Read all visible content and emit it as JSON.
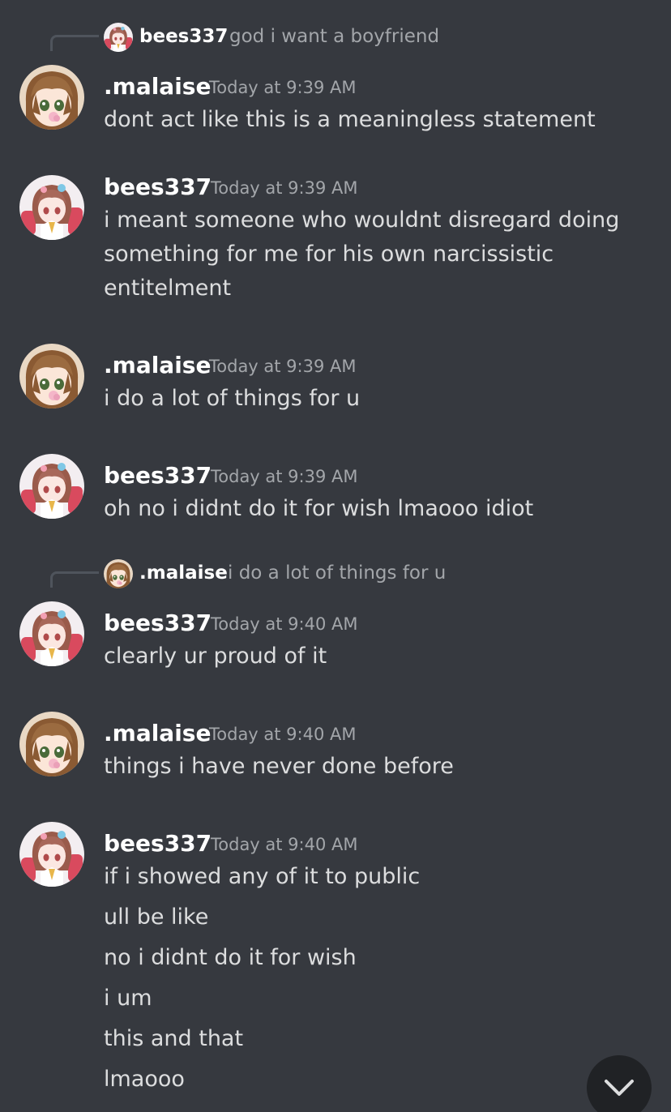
{
  "users": {
    "malaise": ".malaise",
    "bees": "bees337"
  },
  "colors": {
    "background": "#36393f",
    "username": "#ffffff",
    "text": "#dcddde",
    "muted": "#a3a6aa",
    "reply_spine": "#4f545c",
    "scroll_button": "#202225"
  },
  "messages": [
    {
      "reply": {
        "name": "bees337",
        "text": "god i want a boyfriend"
      },
      "author": ".malaise",
      "time": "Today at 9:39 AM",
      "lines": [
        "dont act like this is a meaningless statement"
      ]
    },
    {
      "author": "bees337",
      "time": "Today at 9:39 AM",
      "lines": [
        "i meant someone who wouldnt disregard doing",
        "something for me for his own narcissistic",
        "entitelment"
      ]
    },
    {
      "author": ".malaise",
      "time": "Today at 9:39 AM",
      "lines": [
        "i do a lot of things for u"
      ]
    },
    {
      "author": "bees337",
      "time": "Today at 9:39 AM",
      "lines": [
        "oh no i didnt do it for wish lmaooo idiot"
      ]
    },
    {
      "reply": {
        "name": ".malaise",
        "text": "i do a lot of things for u"
      },
      "author": "bees337",
      "time": "Today at 9:40 AM",
      "lines": [
        "clearly ur proud of it"
      ]
    },
    {
      "author": ".malaise",
      "time": "Today at 9:40 AM",
      "lines": [
        "things i have never done before"
      ]
    },
    {
      "author": "bees337",
      "time": "Today at 9:40 AM",
      "lines": [
        "if i showed any of it to public",
        "ull be like",
        "no i didnt do it for wish",
        "i um",
        "this and that",
        "lmaooo"
      ]
    }
  ],
  "scroll_button": {
    "icon": "chevron-down-icon"
  }
}
